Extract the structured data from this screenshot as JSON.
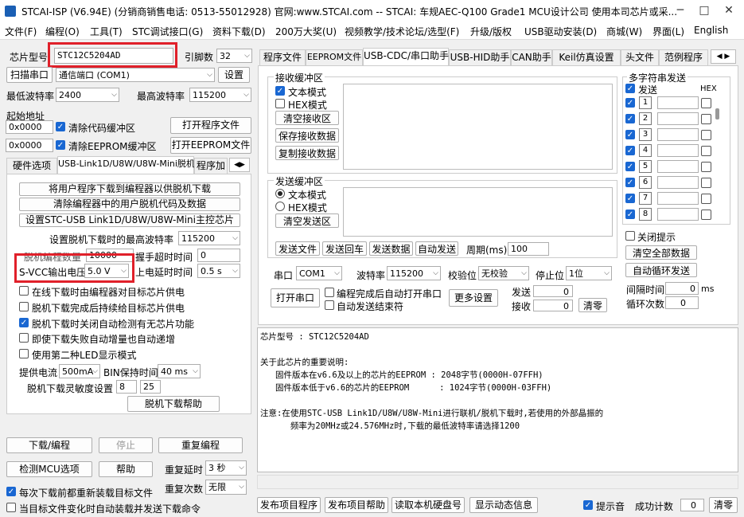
{
  "window": {
    "title": "STCAI-ISP (V6.94E) (分销商销售电话: 0513-55012928) 官网:www.STCAI.com  -- STCAI: 车规AEC-Q100 Grade1 MCU设计公司 使用本司芯片或采..."
  },
  "menu": [
    "文件(F)",
    "编程(O)",
    "工具(T)",
    "STC调试接口(G)",
    "资料下载(D)",
    "200万大奖(U)",
    "视频教学/技术论坛/选型(F)",
    "升级/版权",
    "USB驱动安装(D)",
    "商城(W)",
    "界面(L)",
    "English"
  ],
  "left": {
    "chip_label": "芯片型号",
    "chip_value": "STC12C5204AD",
    "pins_label": "引脚数",
    "pins_value": "32",
    "scan_btn": "扫描串口",
    "port_value": "通信端口 (COM1)",
    "settings_btn": "设置",
    "min_baud_label": "最低波特率",
    "min_baud": "2400",
    "max_baud_label": "最高波特率",
    "max_baud": "115200",
    "start_addr_label": "起始地址",
    "addr1": "0x0000",
    "clear_code": "清除代码缓冲区",
    "open_prog": "打开程序文件",
    "addr2": "0x0000",
    "clear_eeprom": "清除EEPROM缓冲区",
    "open_eeprom": "打开EEPROM文件",
    "tabs": [
      "硬件选项",
      "USB-Link1D/U8W/U8W-Mini脱机",
      "程序加"
    ],
    "btn1": "将用户程序下载到编程器以供脱机下载",
    "btn2": "清除编程器中的用户脱机代码及数据",
    "btn3": "设置STC-USB Link1D/U8W/U8W-Mini主控芯片",
    "offline_baud_label": "设置脱机下载时的最高波特率",
    "offline_baud": "115200",
    "count_label": "脱机编程数量",
    "count_value": "10000",
    "timeout_label": "握手超时时间",
    "timeout_value": "0",
    "vcc_label": "S-VCC输出电压",
    "vcc_value": "5.0 V",
    "delay_label": "上电延时时间",
    "delay_value": "0.5 s",
    "chk1": "在线下载时由编程器对目标芯片供电",
    "chk2": "脱机下载完成后持续给目标芯片供电",
    "chk3": "脱机下载时关闭自动检测有无芯片功能",
    "chk4": "即使下载失败自动增量也自动递增",
    "chk5": "使用第二种LED显示模式",
    "current_label": "提供电流",
    "current_value": "500mA",
    "bin_label": "BIN保持时间",
    "bin_value": "40 ms",
    "sens_label": "脱机下载灵敏度设置",
    "sens1": "8",
    "sens2": "25",
    "help_btn": "脱机下载帮助",
    "download_btn": "下载/编程",
    "stop_btn": "停止",
    "reprog_btn": "重复编程",
    "check_btn": "检测MCU选项",
    "help2_btn": "帮助",
    "repeat_delay_label": "重复延时",
    "repeat_delay": "3 秒",
    "repeat_count_label": "重复次数",
    "repeat_count": "无限",
    "reload_chk": "每次下载前都重新装载目标文件",
    "auto_chk": "当目标文件变化时自动装载并发送下载命令"
  },
  "right": {
    "tabs": [
      "程序文件",
      "EEPROM文件",
      "USB-CDC/串口助手",
      "USB-HID助手",
      "CAN助手",
      "Keil仿真设置",
      "头文件",
      "范例程序"
    ],
    "recv_title": "接收缓冲区",
    "recv_text": "文本模式",
    "recv_hex": "HEX模式",
    "clear_recv": "清空接收区",
    "save_recv": "保存接收数据",
    "copy_recv": "复制接收数据",
    "send_title": "发送缓冲区",
    "send_text": "文本模式",
    "send_hex": "HEX模式",
    "clear_send": "清空发送区",
    "send_file": "发送文件",
    "send_back": "发送回车",
    "send_data": "发送数据",
    "auto_send": "自动发送",
    "period_label": "周期(ms)",
    "period": "100",
    "multi_title": "多字符串发送",
    "send_col": "发送",
    "hex_col": "HEX",
    "rows": [
      "1",
      "2",
      "3",
      "4",
      "5",
      "6",
      "7",
      "8"
    ],
    "close_tip": "关闭提示",
    "clear_all": "清空全部数据",
    "auto_loop": "自动循环发送",
    "interval_label": "间隔时间",
    "interval": "0",
    "interval_unit": "ms",
    "loop_label": "循环次数",
    "loop": "0",
    "port_label": "串口",
    "port": "COM1",
    "baud_label": "波特率",
    "baud": "115200",
    "parity_label": "校验位",
    "parity": "无校验",
    "stop_label": "停止位",
    "stop": "1位",
    "open_port": "打开串口",
    "chk_open": "编程完成后自动打开串口",
    "chk_end": "自动发送结束符",
    "more": "更多设置",
    "sent_label": "发送",
    "sent": "0",
    "recv_label": "接收",
    "recv": "0",
    "clear": "清零",
    "info": [
      "芯片型号 : STC12C5204AD",
      "",
      "关于此芯片的重要说明:",
      "   固件版本在v6.6及以上的芯片的EEPROM : 2048字节(0000H-07FFH)",
      "   固件版本低于v6.6的芯片的EEPROM      : 1024字节(0000H-03FFH)",
      "",
      "注意:在使用STC-USB Link1D/U8W/U8W-Mini进行联机/脱机下载时,若使用的外部晶振的",
      "      频率为20MHz或24.576MHz时,下载的最低波特率请选择1200"
    ],
    "pub_prog": "发布项目程序",
    "pub_help": "发布项目帮助",
    "read_disk": "读取本机硬盘号",
    "show_anim": "显示动态信息",
    "tip_sound": "提示音",
    "success_label": "成功计数",
    "success": "0",
    "clear2": "清零"
  }
}
